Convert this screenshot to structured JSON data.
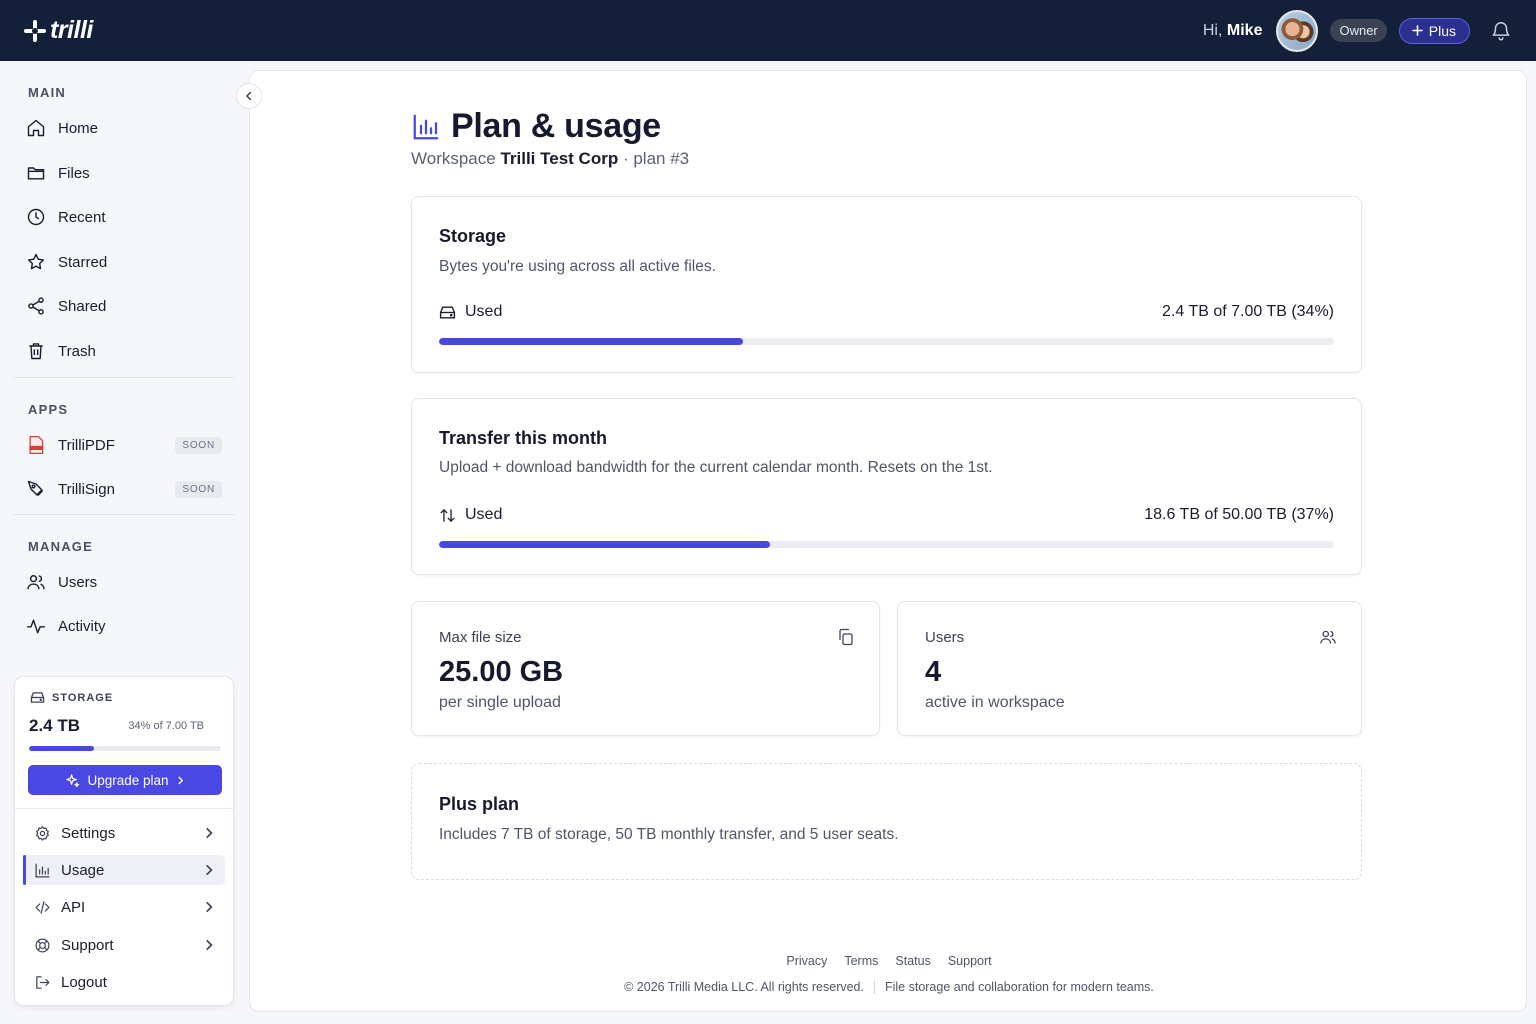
{
  "brand": {
    "name": "trilli"
  },
  "topbar": {
    "greeting_prefix": "Hi,",
    "user_name": "Mike",
    "role_badge": "Owner",
    "plan_button": "Plus"
  },
  "sidebar": {
    "main_label": "MAIN",
    "main_items": [
      {
        "label": "Home",
        "icon": "home-icon"
      },
      {
        "label": "Files",
        "icon": "folder-icon"
      },
      {
        "label": "Recent",
        "icon": "clock-icon"
      },
      {
        "label": "Starred",
        "icon": "star-icon"
      },
      {
        "label": "Shared",
        "icon": "share-icon"
      },
      {
        "label": "Trash",
        "icon": "trash-icon"
      }
    ],
    "apps_label": "APPS",
    "app_items": [
      {
        "label": "TrilliPDF",
        "badge": "SOON",
        "icon": "pdf-icon"
      },
      {
        "label": "TrilliSign",
        "badge": "SOON",
        "icon": "signature-icon"
      }
    ],
    "manage_label": "MANAGE",
    "manage_items": [
      {
        "label": "Users",
        "icon": "users-icon"
      },
      {
        "label": "Activity",
        "icon": "activity-icon"
      }
    ]
  },
  "storage_widget": {
    "heading": "STORAGE",
    "amount": "2.4 TB",
    "percent_text": "34% of 7.00 TB",
    "fill_fraction": 0.34,
    "upgrade_label": "Upgrade plan"
  },
  "account_menu": [
    {
      "label": "Settings",
      "icon": "gear-icon",
      "active": false
    },
    {
      "label": "Usage",
      "icon": "bar-chart-icon",
      "active": true
    },
    {
      "label": "API",
      "icon": "code-icon",
      "active": false
    },
    {
      "label": "Support",
      "icon": "lifebuoy-icon",
      "active": false
    },
    {
      "label": "Logout",
      "icon": "logout-icon",
      "active": false
    }
  ],
  "page": {
    "title": "Plan & usage",
    "subtitle_prefix": "Workspace",
    "workspace": "Trilli Test Corp",
    "subtitle_suffix": "· plan #3"
  },
  "storage_card": {
    "title": "Storage",
    "description": "Bytes you're using across all active files.",
    "used_label": "Used",
    "used_value": "2.4 TB of 7.00 TB (34%)",
    "fill_fraction": 0.34
  },
  "transfer_card": {
    "title": "Transfer this month",
    "description": "Upload + download bandwidth for the current calendar month. Resets on the 1st.",
    "used_label": "Used",
    "used_value": "18.6 TB of 50.00 TB (37%)",
    "fill_fraction": 0.37
  },
  "max_file_card": {
    "label": "Max file size",
    "value": "25.00 GB",
    "sub": "per single upload"
  },
  "users_card": {
    "label": "Users",
    "value": "4",
    "sub": "active in workspace"
  },
  "plan_card": {
    "title": "Plus plan",
    "description": "Includes 7 TB of storage, 50 TB monthly transfer, and 5 user seats."
  },
  "footer": {
    "links": [
      "Privacy",
      "Terms",
      "Status",
      "Support"
    ],
    "copyright": "© 2026 Trilli Media LLC. All rights reserved.",
    "tagline": "File storage and collaboration for modern teams."
  },
  "colors": {
    "accent": "#4847e0",
    "topbar": "#14203a"
  }
}
